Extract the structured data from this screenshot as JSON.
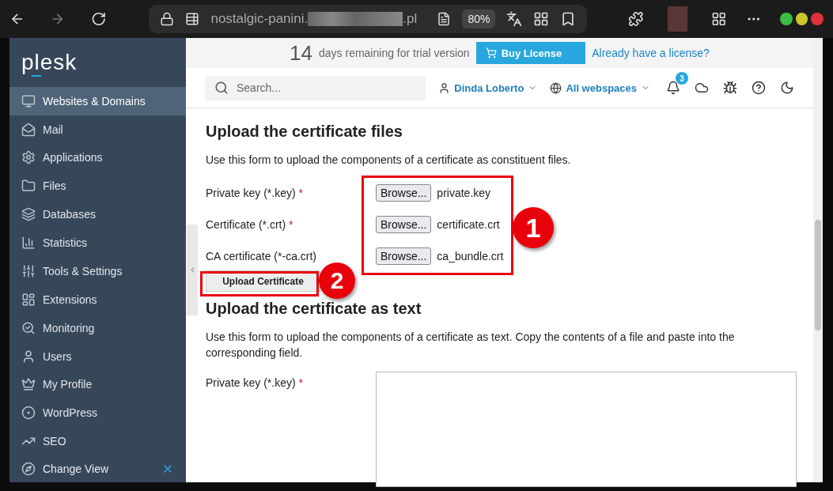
{
  "browser": {
    "host": "nostalgic-panini.",
    "tail": ".pl",
    "zoom": "80%"
  },
  "sidebar": {
    "logo": "plesk",
    "items": [
      {
        "label": "Websites & Domains",
        "selected": true
      },
      {
        "label": "Mail",
        "selected": false
      },
      {
        "label": "Applications",
        "selected": false
      },
      {
        "label": "Files",
        "selected": false
      },
      {
        "label": "Databases",
        "selected": false
      },
      {
        "label": "Statistics",
        "selected": false
      },
      {
        "label": "Tools & Settings",
        "selected": false
      },
      {
        "label": "Extensions",
        "selected": false
      },
      {
        "label": "Monitoring",
        "selected": false
      },
      {
        "label": "Users",
        "selected": false
      },
      {
        "label": "My Profile",
        "selected": false
      },
      {
        "label": "WordPress",
        "selected": false
      },
      {
        "label": "SEO",
        "selected": false
      }
    ],
    "footer": "Change View"
  },
  "trial": {
    "days": "14",
    "text": "days remaining for trial version",
    "buy": "Buy License",
    "link": "Already have a license?"
  },
  "header": {
    "search_placeholder": "Search...",
    "user": "Dinda Loberto",
    "webspace": "All webspaces",
    "notifications": "3"
  },
  "files_section": {
    "title": "Upload the certificate files",
    "description": "Use this form to upload the components of a certificate as constituent files.",
    "fields": [
      {
        "label": "Private key (*.key)",
        "required": true,
        "button": "Browse...",
        "file": "private.key"
      },
      {
        "label": "Certificate (*.crt)",
        "required": true,
        "button": "Browse...",
        "file": "certificate.crt"
      },
      {
        "label": "CA certificate (*-ca.crt)",
        "required": false,
        "button": "Browse...",
        "file": "ca_bundle.crt"
      }
    ],
    "submit": "Upload Certificate"
  },
  "text_section": {
    "title": "Upload the certificate as text",
    "description": "Use this form to upload the components of a certificate as text. Copy the contents of a file and paste into the corresponding field.",
    "fields": [
      {
        "label": "Private key (*.key)",
        "required": true
      }
    ]
  },
  "required_mark": "*",
  "annotations": [
    "1",
    "2"
  ]
}
